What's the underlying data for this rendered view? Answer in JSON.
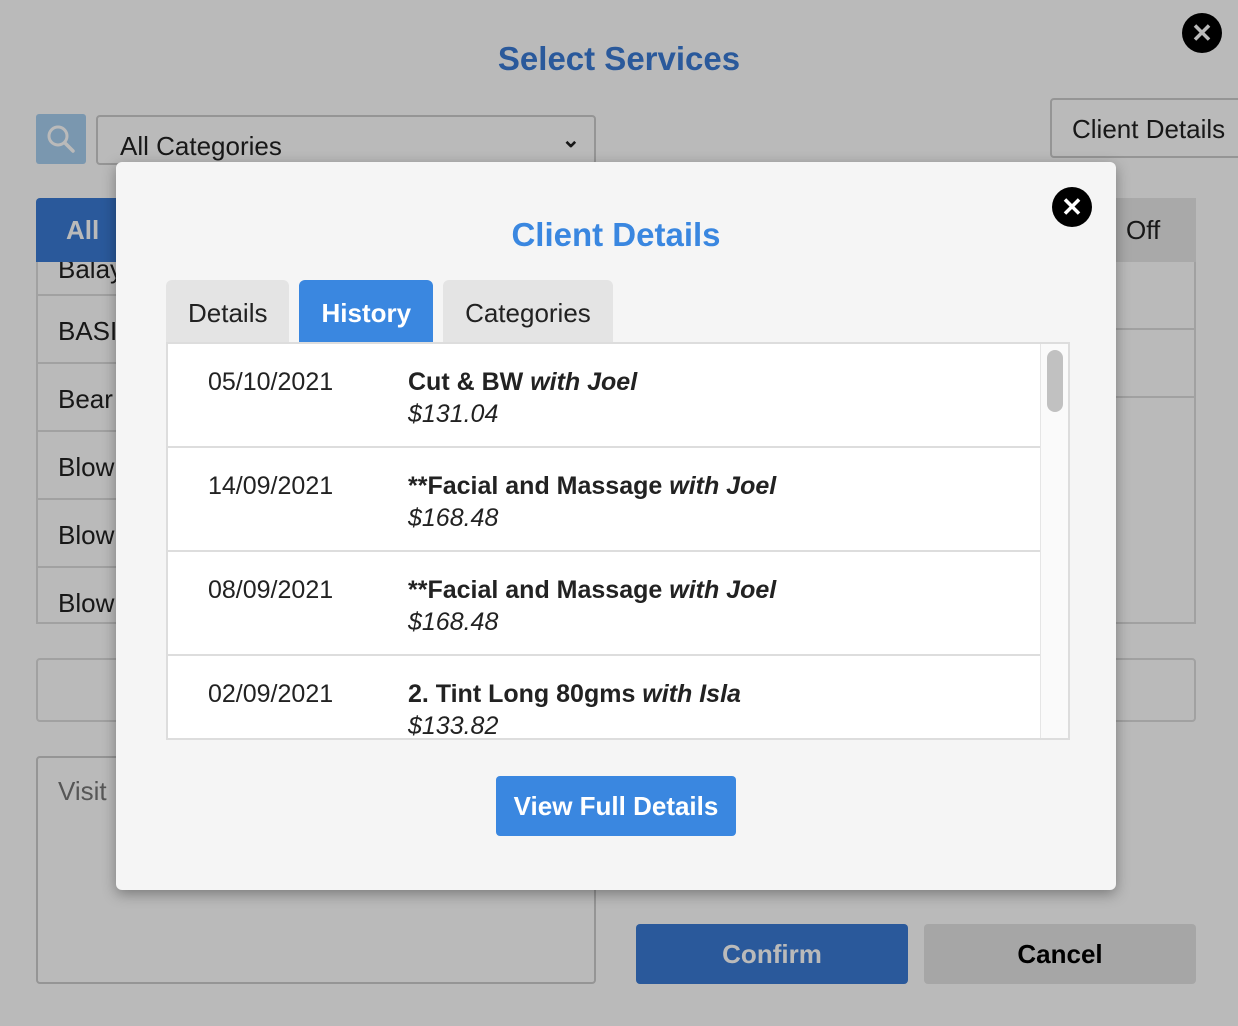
{
  "background": {
    "title": "Select Services",
    "category_select": {
      "value": "All Categories"
    },
    "client_details_button": "Client Details",
    "tab_all": "All",
    "tab_off": "Off",
    "service_list": [
      "Balay",
      "BASI",
      "Bear",
      "Blow",
      "Blow",
      "Blow"
    ],
    "notes_placeholder": "Visit",
    "confirm_label": "Confirm",
    "cancel_label": "Cancel"
  },
  "modal": {
    "title": "Client Details",
    "tabs": [
      {
        "label": "Details",
        "active": false
      },
      {
        "label": "History",
        "active": true
      },
      {
        "label": "Categories",
        "active": false
      }
    ],
    "history": [
      {
        "date": "05/10/2021",
        "service": "Cut & BW",
        "with": "with Joel",
        "price": "$131.04"
      },
      {
        "date": "14/09/2021",
        "service": "**Facial and Massage",
        "with": "with Joel",
        "price": "$168.48"
      },
      {
        "date": "08/09/2021",
        "service": "**Facial and Massage",
        "with": "with Joel",
        "price": "$168.48"
      },
      {
        "date": "02/09/2021",
        "service": "2. Tint Long 80gms",
        "with": "with Isla",
        "price": "$133.82"
      }
    ],
    "view_full_details_label": "View Full Details"
  },
  "colors": {
    "accent": "#3a87e0",
    "close_button": "#000000",
    "overlay": "rgba(0,0,0,0.27)"
  }
}
